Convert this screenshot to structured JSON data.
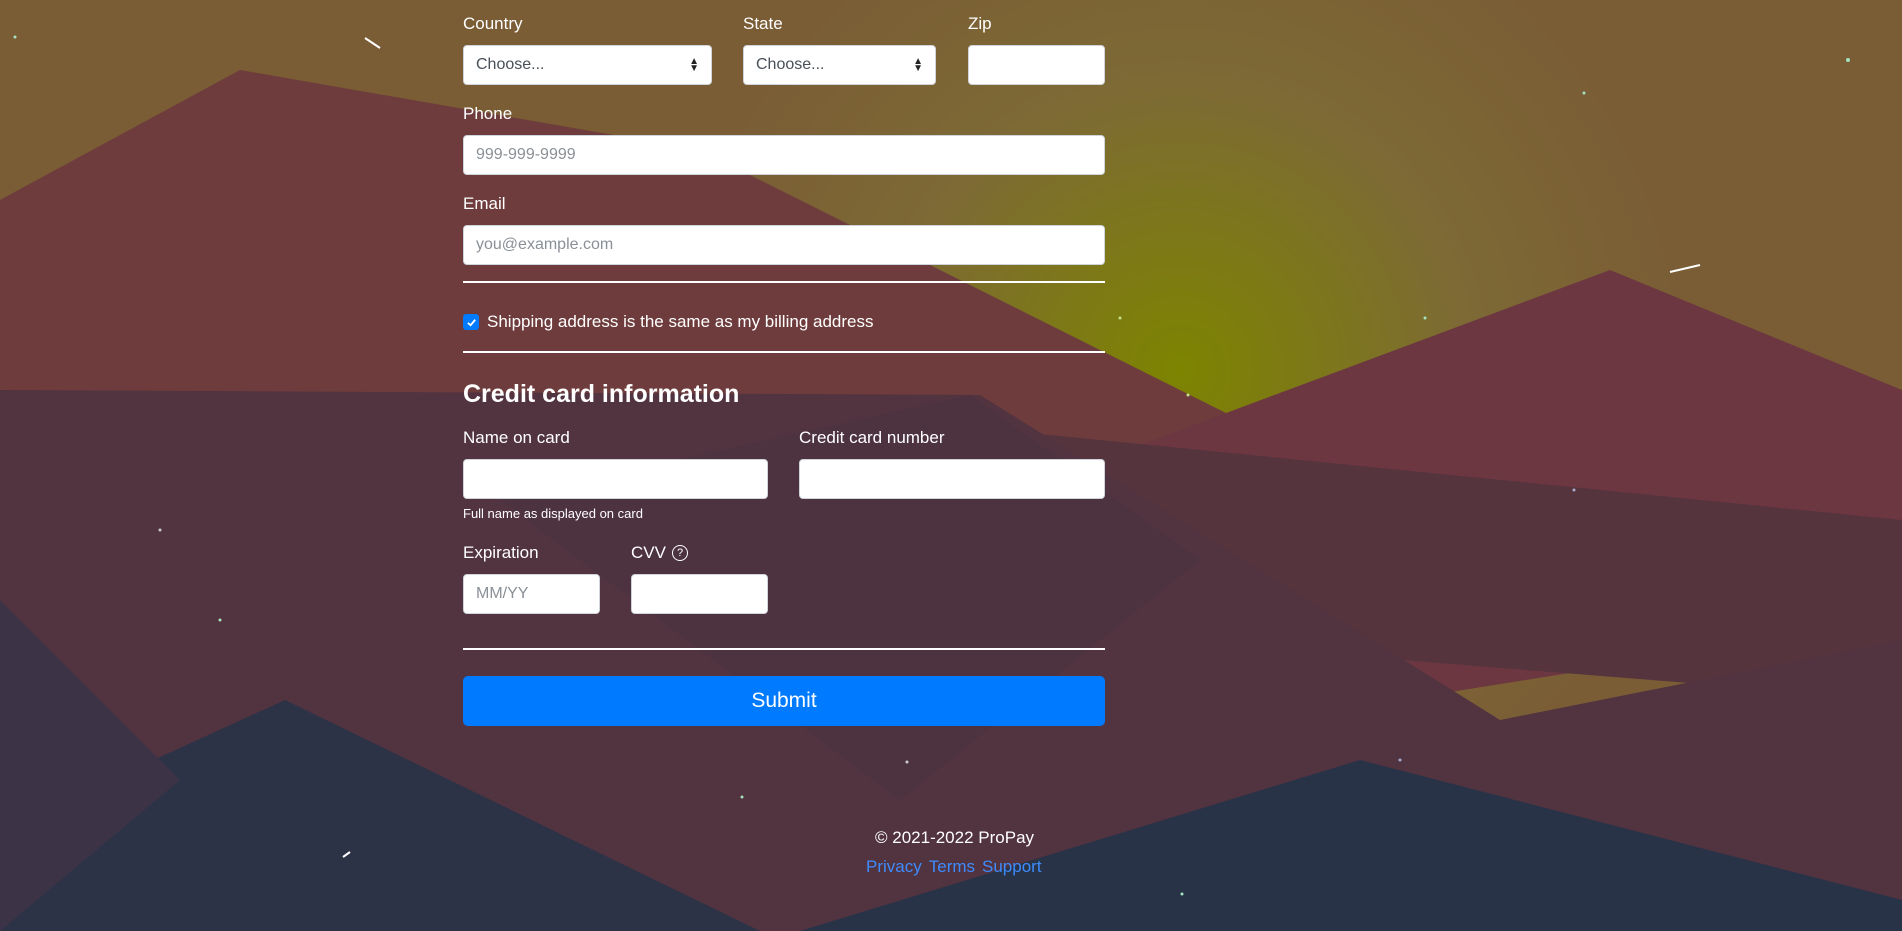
{
  "address": {
    "country_label": "Country",
    "country_value": "Choose...",
    "state_label": "State",
    "state_value": "Choose...",
    "zip_label": "Zip",
    "zip_value": "",
    "phone_label": "Phone",
    "phone_placeholder": "999-999-9999",
    "email_label": "Email",
    "email_placeholder": "you@example.com",
    "same_address_label": "Shipping address is the same as my billing address",
    "same_address_checked": true
  },
  "payment": {
    "heading": "Credit card information",
    "name_label": "Name on card",
    "name_help": "Full name as displayed on card",
    "number_label": "Credit card number",
    "expiration_label": "Expiration",
    "expiration_placeholder": "MM/YY",
    "cvv_label": "CVV",
    "cvv_help_icon": "?"
  },
  "submit_label": "Submit",
  "footer": {
    "copyright": "© 2021-2022 ProPay",
    "links": [
      "Privacy",
      "Terms",
      "Support"
    ]
  },
  "colors": {
    "accent": "#007bff",
    "link": "#3d8bfd"
  }
}
